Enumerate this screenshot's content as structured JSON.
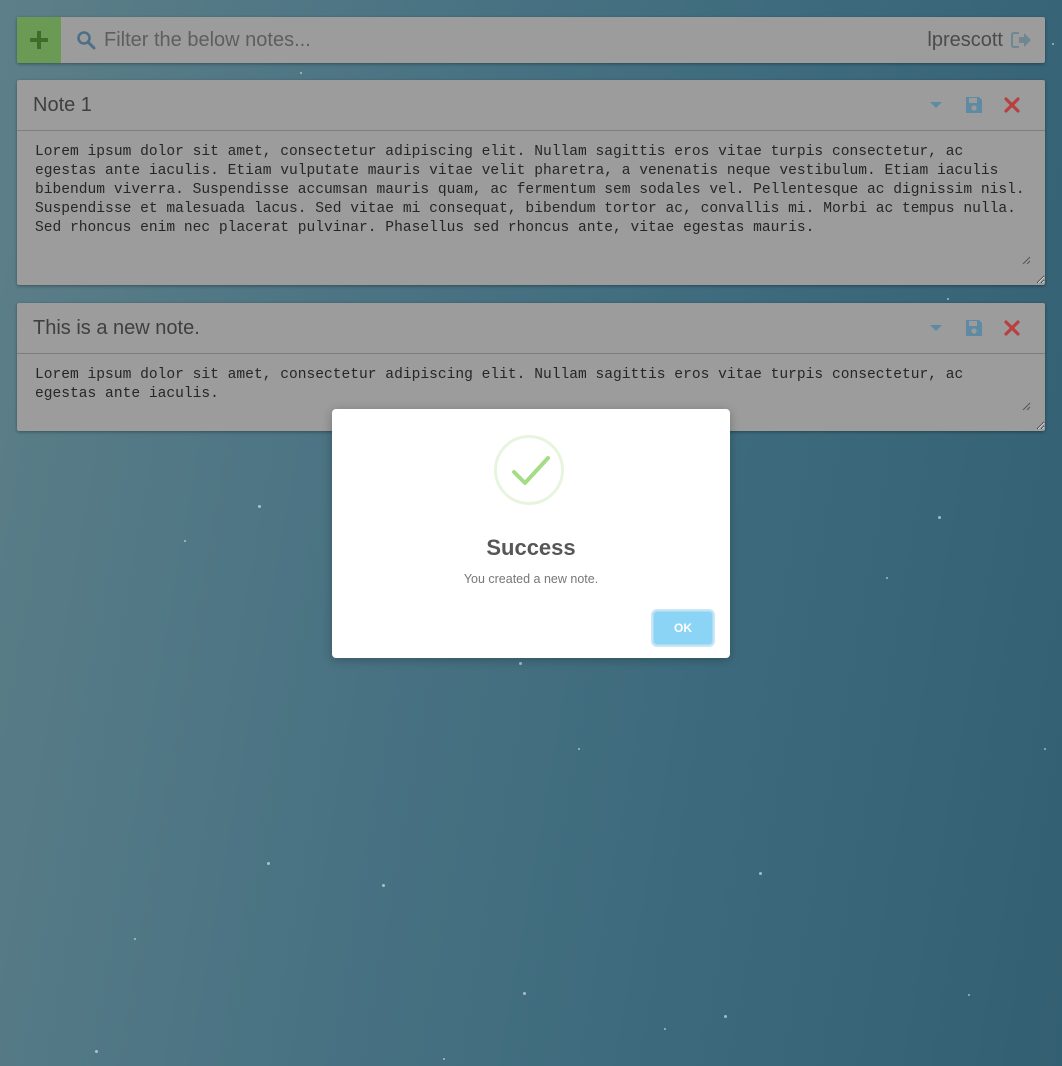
{
  "header": {
    "search_placeholder": "Filter the below notes...",
    "username": "lprescott",
    "icons": {
      "add": "plus-icon",
      "search": "search-icon",
      "logout": "sign-out-icon"
    },
    "colors": {
      "add_button": "#6a9a54",
      "bar": "#9c9c9c"
    }
  },
  "notes": [
    {
      "title": "Note 1",
      "body": "Lorem ipsum dolor sit amet, consectetur adipiscing elit. Nullam sagittis eros vitae turpis consectetur, ac egestas ante iaculis. Etiam vulputate mauris vitae velit pharetra, a venenatis neque vestibulum. Etiam iaculis bibendum viverra. Suspendisse accumsan mauris quam, ac fermentum sem sodales vel. Pellentesque ac dignissim nisl. Suspendisse et malesuada lacus. Sed vitae mi consequat, bibendum tortor ac, convallis mi. Morbi ac tempus nulla. Sed rhoncus enim nec placerat pulvinar. Phasellus sed rhoncus ante, vitae egestas mauris.",
      "icons": [
        "caret-down-icon",
        "save-icon",
        "delete-icon"
      ]
    },
    {
      "title": "This is a new note.",
      "body": "Lorem ipsum dolor sit amet, consectetur adipiscing elit. Nullam sagittis eros vitae turpis consectetur, ac egestas ante iaculis.",
      "icons": [
        "caret-down-icon",
        "save-icon",
        "delete-icon"
      ]
    }
  ],
  "dialog": {
    "title": "Success",
    "message": "You created a new note.",
    "confirm_label": "OK",
    "icon": "checkmark-icon",
    "colors": {
      "check": "#a5dc86",
      "button": "#8cd4f5"
    }
  }
}
